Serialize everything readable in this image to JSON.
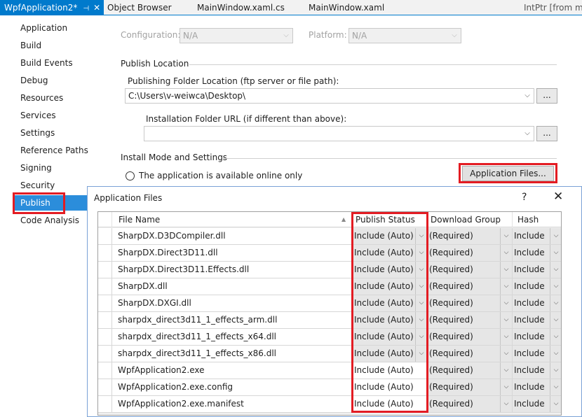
{
  "tabs": [
    {
      "label": "WpfApplication2*",
      "active": true
    },
    {
      "label": "Object Browser"
    },
    {
      "label": "MainWindow.xaml.cs"
    },
    {
      "label": "MainWindow.xaml"
    },
    {
      "label": "IntPtr [from met"
    }
  ],
  "pin_glyph": "⊣",
  "close_glyph": "✕",
  "nav": {
    "items": [
      "Application",
      "Build",
      "Build Events",
      "Debug",
      "Resources",
      "Services",
      "Settings",
      "Reference Paths",
      "Signing",
      "Security",
      "Publish",
      "Code Analysis"
    ],
    "selected": "Publish"
  },
  "config": {
    "configuration_label": "Configuration:",
    "configuration_value": "N/A",
    "platform_label": "Platform:",
    "platform_value": "N/A"
  },
  "publish_location": {
    "section_title": "Publish Location",
    "folder_label": "Publishing Folder Location (ftp server or file path):",
    "folder_value": "C:\\Users\\v-weiwca\\Desktop\\",
    "install_url_label": "Installation Folder URL (if different than above):",
    "install_url_value": "",
    "browse_label": "..."
  },
  "install_mode": {
    "section_title": "Install Mode and Settings",
    "radio_online_label": "The application is available online only",
    "app_files_button": "Application Files..."
  },
  "dialog": {
    "title": "Application Files",
    "help_glyph": "?",
    "close_glyph": "✕",
    "columns": [
      "File Name",
      "Publish Status",
      "Download Group",
      "Hash"
    ],
    "rows": [
      {
        "file": "SharpDX.D3DCompiler.dll",
        "status": "Include (Auto)",
        "group": "(Required)",
        "hash": "Include"
      },
      {
        "file": "SharpDX.Direct3D11.dll",
        "status": "Include (Auto)",
        "group": "(Required)",
        "hash": "Include"
      },
      {
        "file": "SharpDX.Direct3D11.Effects.dll",
        "status": "Include (Auto)",
        "group": "(Required)",
        "hash": "Include"
      },
      {
        "file": "SharpDX.dll",
        "status": "Include (Auto)",
        "group": "(Required)",
        "hash": "Include"
      },
      {
        "file": "SharpDX.DXGI.dll",
        "status": "Include (Auto)",
        "group": "(Required)",
        "hash": "Include"
      },
      {
        "file": "sharpdx_direct3d11_1_effects_arm.dll",
        "status": "Include (Auto)",
        "group": "(Required)",
        "hash": "Include"
      },
      {
        "file": "sharpdx_direct3d11_1_effects_x64.dll",
        "status": "Include (Auto)",
        "group": "(Required)",
        "hash": "Include"
      },
      {
        "file": "sharpdx_direct3d11_1_effects_x86.dll",
        "status": "Include (Auto)",
        "group": "(Required)",
        "hash": "Include"
      },
      {
        "file": "WpfApplication2.exe",
        "status": "Include (Auto)",
        "group": "(Required)",
        "hash": "Include"
      },
      {
        "file": "WpfApplication2.exe.config",
        "status": "Include (Auto)",
        "group": "(Required)",
        "hash": "Include"
      },
      {
        "file": "WpfApplication2.exe.manifest",
        "status": "Include (Auto)",
        "group": "(Required)",
        "hash": "Include"
      }
    ]
  },
  "colors": {
    "accent": "#007acc",
    "nav_selected": "#2b8ddb",
    "highlight_box": "#e31c23"
  }
}
